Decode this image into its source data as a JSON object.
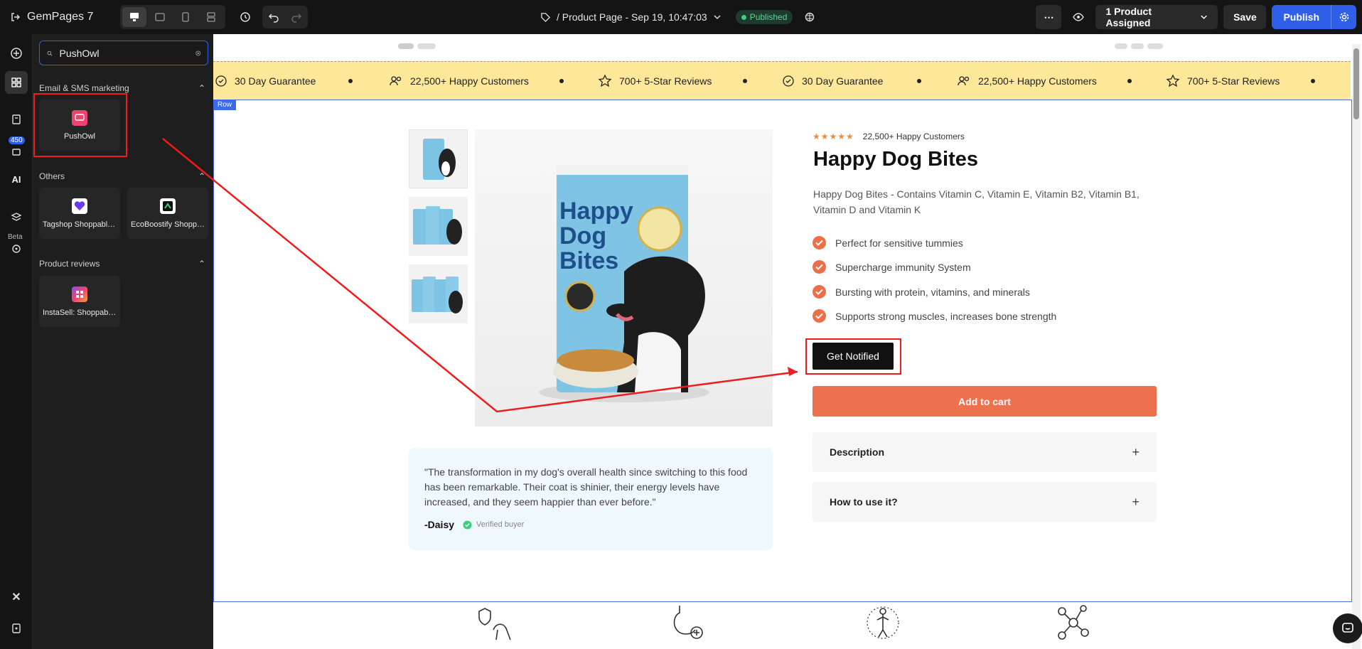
{
  "topbar": {
    "app_name": "GemPages 7",
    "page_title": "/ Product Page - Sep 19, 10:47:03",
    "status": "Published",
    "product_assigned": "1 Product Assigned",
    "save_label": "Save",
    "publish_label": "Publish"
  },
  "rail": {
    "badge": "450",
    "beta": "Beta",
    "ai": "AI"
  },
  "panel": {
    "search": {
      "value": "PushOwl",
      "placeholder": "Search"
    },
    "sections": [
      {
        "title": "Email & SMS marketing",
        "items": [
          {
            "label": "PushOwl"
          }
        ]
      },
      {
        "title": "Others",
        "items": [
          {
            "label": "Tagshop Shoppable..."
          },
          {
            "label": "EcoBoostify Shoppable..."
          }
        ]
      },
      {
        "title": "Product reviews",
        "items": [
          {
            "label": "InstaSell: Shoppable..."
          }
        ]
      }
    ]
  },
  "canvas": {
    "marquee": [
      "30 Day Guarantee",
      "22,500+ Happy Customers",
      "700+ 5-Star Reviews",
      "30 Day Guarantee",
      "22,500+ Happy Customers",
      "700+ 5-Star Reviews"
    ],
    "row_tag": "Row",
    "product": {
      "rating_stars": "★★★★★",
      "rating_text": "22,500+ Happy Customers",
      "title": "Happy Dog Bites",
      "description": "Happy Dog Bites - Contains Vitamin C, Vitamin E, Vitamin B2, Vitamin B1, Vitamin D and Vitamin K",
      "bullets": [
        "Perfect for sensitive tummies",
        "Supercharge immunity System",
        "Bursting with protein, vitamins, and minerals",
        "Supports strong muscles, increases bone strength"
      ],
      "notify_label": "Get Notified",
      "cart_label": "Add to cart",
      "accordions": [
        "Description",
        "How to use it?"
      ],
      "package_text": [
        "Happy",
        "Dog",
        "Bites"
      ]
    },
    "review": {
      "text": "\"The transformation in my dog's overall health since switching to this food has been remarkable. Their coat is shinier, their energy levels have increased, and they seem happier than ever before.\"",
      "author": "-Daisy",
      "verified": "Verified buyer"
    }
  },
  "colors": {
    "accent": "#2f5fe8",
    "cart": "#ee714d",
    "marquee_bg": "#fde89a",
    "highlight": "#ee1c1c"
  }
}
